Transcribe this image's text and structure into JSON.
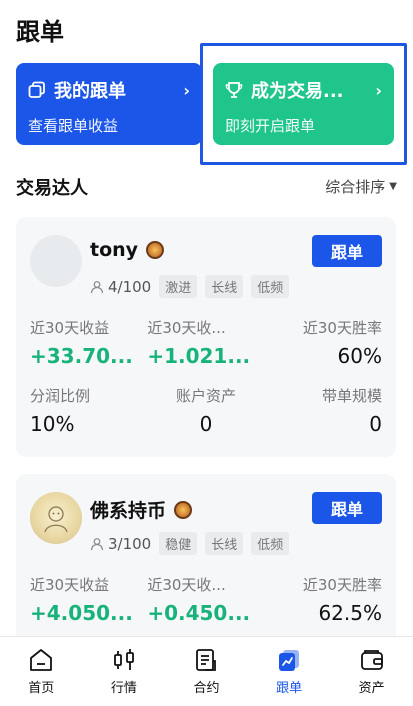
{
  "page": {
    "title": "跟单"
  },
  "promo": {
    "my_follow": {
      "title": "我的跟单",
      "subtitle": "查看跟单收益"
    },
    "become_trader": {
      "title": "成为交易...",
      "subtitle": "即刻开启跟单"
    }
  },
  "section": {
    "title": "交易达人",
    "sort_label": "综合排序"
  },
  "traders": [
    {
      "name": "tony",
      "followers": "4/100",
      "tags": [
        "激进",
        "长线",
        "低频"
      ],
      "follow_label": "跟单",
      "stats": {
        "roi_label": "近30天收益",
        "roi": "+33.70...",
        "pnl_label": "近30天收...",
        "pnl": "+1.021...",
        "winrate_label": "近30天胜率",
        "winrate": "60%",
        "share_label": "分润比例",
        "share": "10%",
        "assets_label": "账户资产",
        "assets": "0",
        "scale_label": "带单规模",
        "scale": "0"
      }
    },
    {
      "name": "佛系持币",
      "followers": "3/100",
      "tags": [
        "稳健",
        "长线",
        "低频"
      ],
      "follow_label": "跟单",
      "stats": {
        "roi_label": "近30天收益",
        "roi": "+4.050...",
        "pnl_label": "近30天收...",
        "pnl": "+0.450...",
        "winrate_label": "近30天胜率",
        "winrate": "62.5%"
      }
    }
  ],
  "tabbar": [
    {
      "label": "首页",
      "icon": "home-icon"
    },
    {
      "label": "行情",
      "icon": "candlestick-icon"
    },
    {
      "label": "合约",
      "icon": "contract-icon"
    },
    {
      "label": "跟单",
      "icon": "copy-trade-icon",
      "active": true
    },
    {
      "label": "资产",
      "icon": "wallet-icon"
    }
  ],
  "colors": {
    "primary": "#1b56e8",
    "green": "#1fc58b",
    "profit": "#18b37a"
  }
}
